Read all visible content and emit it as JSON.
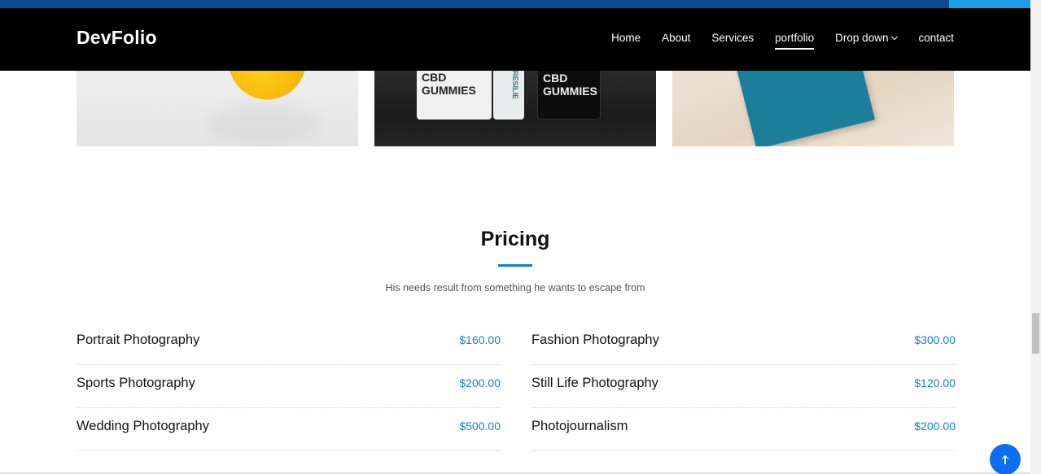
{
  "header": {
    "brand": "DevFolio",
    "nav": [
      {
        "label": "Home"
      },
      {
        "label": "About"
      },
      {
        "label": "Services"
      },
      {
        "label": "portfolio",
        "active": true
      },
      {
        "label": "Drop down",
        "dropdown": true
      },
      {
        "label": "contact"
      }
    ]
  },
  "portfolio": {
    "pouch_white": "CBD GUMMIES",
    "pouch_box": "RESILIE",
    "pouch_black": "CBD GUMMIES"
  },
  "pricing": {
    "title": "Pricing",
    "subtitle": "His needs result from something he wants to escape from",
    "left": [
      {
        "name": "Portrait Photography",
        "price": "$160.00"
      },
      {
        "name": "Sports Photography",
        "price": "$200.00"
      },
      {
        "name": "Wedding Photography",
        "price": "$500.00"
      }
    ],
    "right": [
      {
        "name": "Fashion Photography",
        "price": "$300.00"
      },
      {
        "name": "Still Life Photography",
        "price": "$120.00"
      },
      {
        "name": "Photojournalism",
        "price": "$200.00"
      }
    ]
  },
  "colors": {
    "accent": "#1a7fd1",
    "navbar_bg": "#000000",
    "back_to_top": "#0c6cf2"
  },
  "icons": {
    "back_to_top": "arrow-up-icon",
    "dropdown": "chevron-down-icon"
  }
}
